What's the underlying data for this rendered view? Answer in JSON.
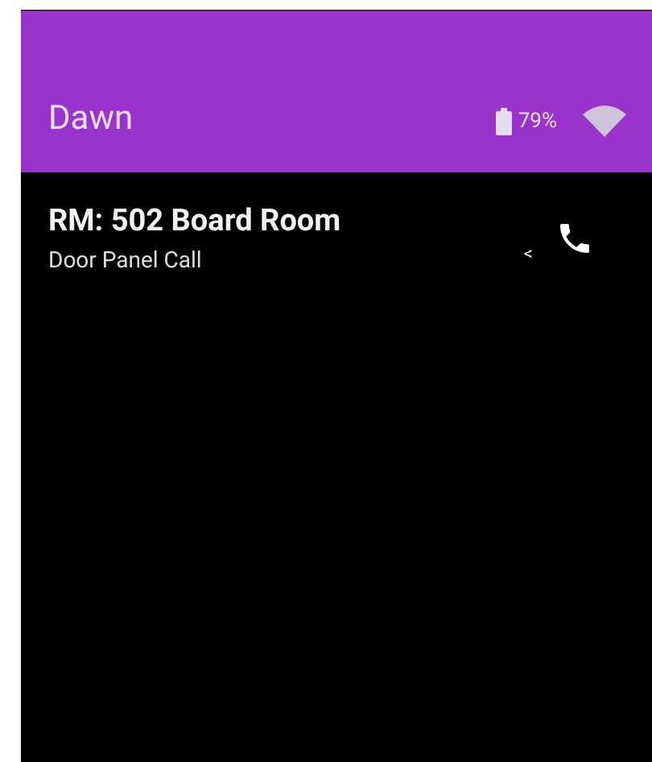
{
  "app_bar": {
    "title": "Dawn",
    "battery": "79%"
  },
  "calls": [
    {
      "title": "RM: 502 Board Room",
      "subtitle": "Door Panel Call",
      "indicator": "<"
    }
  ]
}
